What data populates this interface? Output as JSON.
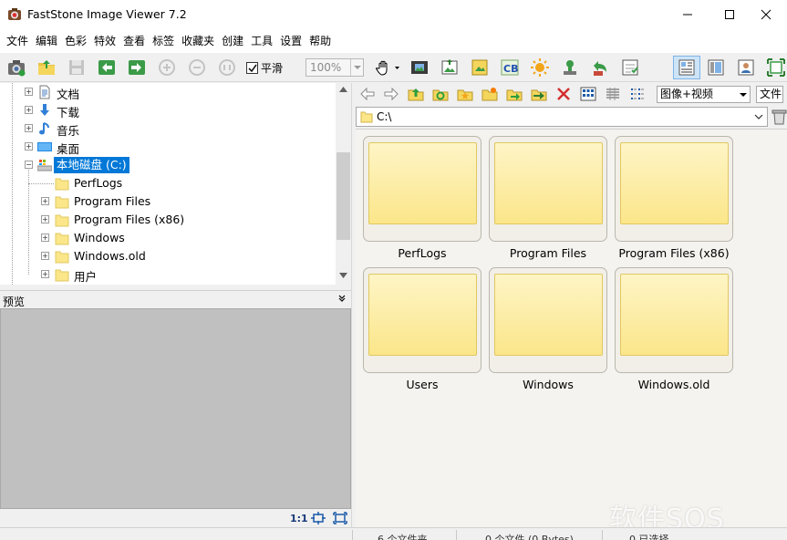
{
  "window": {
    "title": "FastStone Image Viewer 7.2"
  },
  "menu": [
    "文件",
    "编辑",
    "色彩",
    "特效",
    "查看",
    "标签",
    "收藏夹",
    "创建",
    "工具",
    "设置",
    "帮助"
  ],
  "toolbar": {
    "smooth_label": "平滑",
    "smooth_checked": true,
    "zoom_value": "100%"
  },
  "tree": {
    "items": [
      {
        "label": "文档",
        "icon": "document-icon",
        "level": 0
      },
      {
        "label": "下载",
        "icon": "download-icon",
        "level": 0
      },
      {
        "label": "音乐",
        "icon": "music-icon",
        "level": 0
      },
      {
        "label": "桌面",
        "icon": "desktop-icon",
        "level": 0
      },
      {
        "label": "本地磁盘 (C:)",
        "icon": "drive-icon",
        "level": 0,
        "selected": true
      },
      {
        "label": "PerfLogs",
        "icon": "folder-icon",
        "level": 1
      },
      {
        "label": "Program Files",
        "icon": "folder-icon",
        "level": 1
      },
      {
        "label": "Program Files (x86)",
        "icon": "folder-icon",
        "level": 1
      },
      {
        "label": "Windows",
        "icon": "folder-icon",
        "level": 1
      },
      {
        "label": "Windows.old",
        "icon": "folder-icon",
        "level": 1
      },
      {
        "label": "用户",
        "icon": "folder-icon",
        "level": 1
      }
    ]
  },
  "preview": {
    "title": "预览",
    "ratio_label": "1:1"
  },
  "browser": {
    "filter_value": "图像+视频",
    "sort_value": "文件名",
    "path": "C:\\"
  },
  "thumbnails": [
    {
      "label": "PerfLogs"
    },
    {
      "label": "Program Files"
    },
    {
      "label": "Program Files (x86)"
    },
    {
      "label": "Users"
    },
    {
      "label": "Windows"
    },
    {
      "label": "Windows.old"
    }
  ],
  "status": {
    "folders": "6 个文件夹",
    "files": "0 个文件 (0 Bytes)",
    "selected": "0 已选择"
  },
  "watermark": "软件SOS",
  "colors": {
    "selection": "#0078d7",
    "folder_fill": "#fbe68a"
  }
}
